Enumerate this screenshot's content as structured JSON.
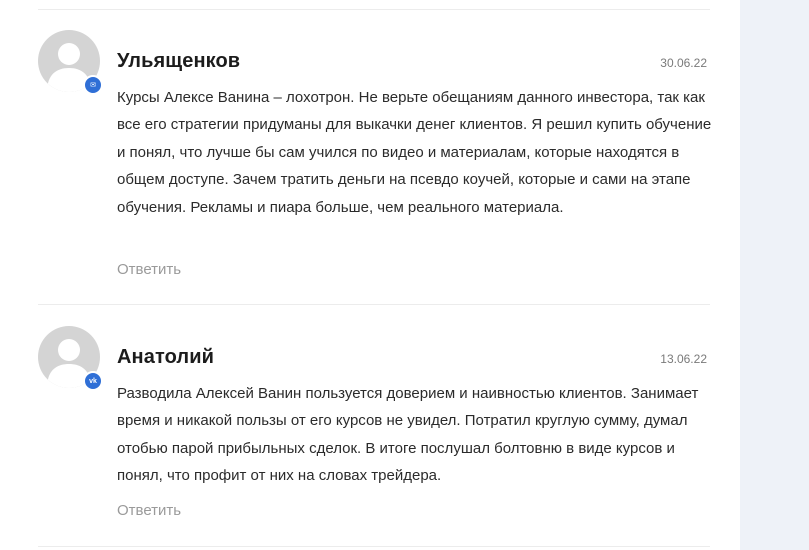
{
  "comments": [
    {
      "author": "Ульященков",
      "date": "30.06.22",
      "text": "Курсы Алексе Ванина – лохотрон. Не верьте обещаниям данного инвестора, так как все его стратегии придуманы для выкачки денег клиентов. Я решил купить обучение и понял, что лучше бы сам учился по видео и материалам, которые находятся в общем доступе. Зачем тратить деньги на псевдо коучей, которые и сами на этапе обучения. Рекламы и пиара больше, чем реального материала.",
      "reply_label": "Ответить",
      "badge_icon": "mail-icon",
      "badge_glyph": "✉"
    },
    {
      "author": "Анатолий",
      "date": "13.06.22",
      "text": "Разводила Алексей Ванин пользуется доверием и наивностью клиентов. Занимает время и никакой пользы от его курсов не увидел. Потратил круглую сумму, думал отобью парой прибыльных сделок. В итоге послушал болтовню в виде курсов и понял, что профит от них на словах трейдера.",
      "reply_label": "Ответить",
      "badge_icon": "vk-icon",
      "badge_glyph": "vk"
    }
  ],
  "colors": {
    "page_background": "#eef2f8",
    "panel_background": "#ffffff",
    "badge": "#2f6fd6",
    "reply_link": "#9a9a9a"
  }
}
